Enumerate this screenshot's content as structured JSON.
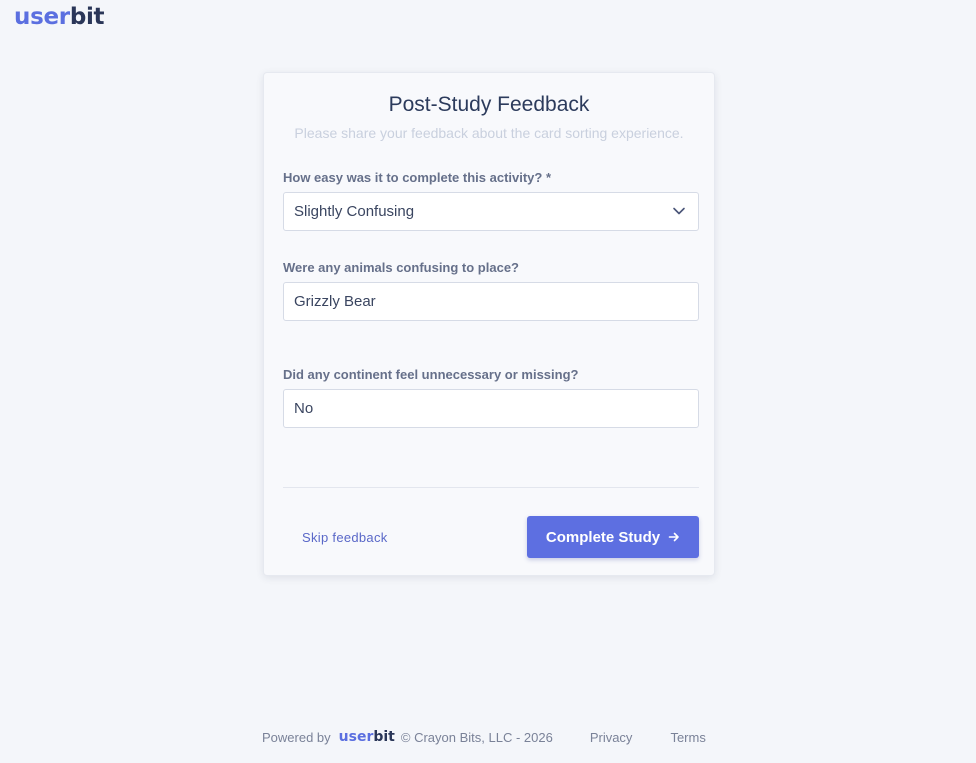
{
  "brand": {
    "part1": "user",
    "part2": "bit"
  },
  "form": {
    "title": "Post-Study Feedback",
    "subtitle": "Please share your feedback about the card sorting experience.",
    "q1": {
      "label": "How easy was it to complete this activity? *",
      "value": "Slightly Confusing"
    },
    "q2": {
      "label": "Were any animals confusing to place?",
      "value": "Grizzly Bear"
    },
    "q3": {
      "label": "Did any continent feel unnecessary or missing?",
      "value": "No"
    },
    "skip_label": "Skip feedback",
    "complete_label": "Complete Study"
  },
  "footer": {
    "powered_by": "Powered by",
    "copyright": "© Crayon Bits, LLC - 2026",
    "privacy": "Privacy",
    "terms": "Terms"
  },
  "colors": {
    "accent": "#5d6fe1",
    "brand_dark": "#2a3658",
    "background": "#f4f6fa"
  },
  "icons": {
    "select": "chevron-down-icon",
    "button": "arrow-right-icon"
  }
}
